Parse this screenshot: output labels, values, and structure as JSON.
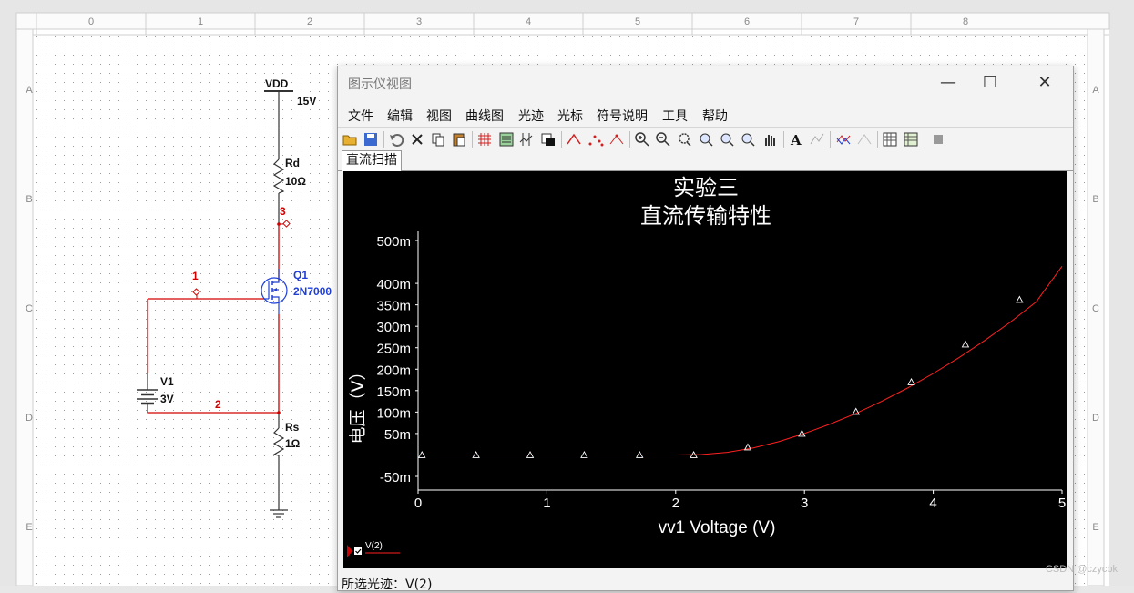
{
  "ruler": {
    "columns": [
      "0",
      "1",
      "2",
      "3",
      "4",
      "5",
      "6",
      "7",
      "8"
    ],
    "rows": [
      "A",
      "B",
      "C",
      "D",
      "E"
    ]
  },
  "schematic": {
    "vdd_label": "VDD",
    "vdd_value": "15V",
    "rd_name": "Rd",
    "rd_value": "10Ω",
    "node3": "3",
    "node1": "1",
    "node2": "2",
    "q1_name": "Q1",
    "q1_model": "2N7000",
    "v1_name": "V1",
    "v1_value": "3V",
    "rs_name": "Rs",
    "rs_value": "1Ω"
  },
  "grapher": {
    "title": "图示仪视图",
    "menu": [
      "文件",
      "编辑",
      "视图",
      "曲线图",
      "光迹",
      "光标",
      "符号说明",
      "工具",
      "帮助"
    ],
    "tab_label": "直流扫描",
    "status_text": "所选光迹：V(2)",
    "legend_label": "V(2)"
  },
  "chart_data": {
    "type": "line",
    "title": "实验三",
    "subtitle": "直流传输特性",
    "xlabel": "vv1 Voltage (V)",
    "ylabel": "电压（V）",
    "xlim": [
      0,
      5
    ],
    "x_ticks": [
      "0",
      "1",
      "2",
      "3",
      "4",
      "5"
    ],
    "y_ticks": [
      {
        "label": "500m",
        "value": 0.5
      },
      {
        "label": "400m",
        "value": 0.4
      },
      {
        "label": "350m",
        "value": 0.35
      },
      {
        "label": "300m",
        "value": 0.3
      },
      {
        "label": "250m",
        "value": 0.25
      },
      {
        "label": "200m",
        "value": 0.2
      },
      {
        "label": "150m",
        "value": 0.15
      },
      {
        "label": "100m",
        "value": 0.1
      },
      {
        "label": "50m",
        "value": 0.05
      },
      {
        "label": "-50m",
        "value": -0.05
      }
    ],
    "grid": false,
    "legend": "bottom-left",
    "series": [
      {
        "name": "V(2)",
        "color": "#ff2020",
        "x": [
          0,
          0.5,
          1,
          1.5,
          2,
          2.2,
          2.4,
          2.6,
          2.8,
          3,
          3.2,
          3.4,
          3.6,
          3.8,
          4,
          4.2,
          4.4,
          4.6,
          4.8,
          5
        ],
        "y": [
          0,
          0,
          0,
          0,
          0,
          0.001,
          0.006,
          0.016,
          0.031,
          0.05,
          0.072,
          0.097,
          0.125,
          0.156,
          0.19,
          0.227,
          0.267,
          0.31,
          0.357,
          0.44
        ],
        "marker_x": [
          0.03,
          0.45,
          0.87,
          1.29,
          1.72,
          2.14,
          2.56,
          2.98,
          3.4,
          3.83,
          4.25,
          4.67
        ],
        "marker_y": [
          0,
          0,
          0,
          0,
          0,
          0,
          0.018,
          0.05,
          0.101,
          0.17,
          0.258,
          0.362
        ]
      }
    ]
  },
  "watermark": "CSDN @czycbk"
}
